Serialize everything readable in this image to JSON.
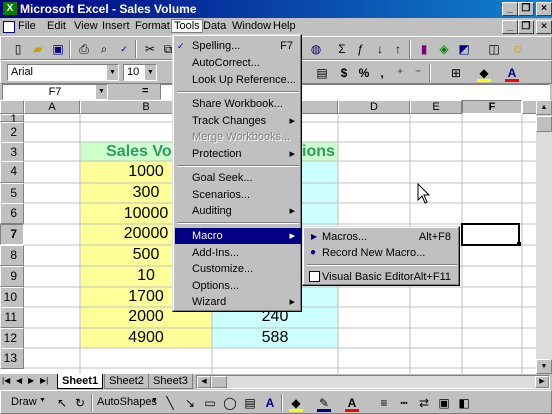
{
  "title_bar": {
    "title": "Microsoft Excel - Sales Volume",
    "min": "_",
    "restore": "❐",
    "close": "×"
  },
  "doc_controls": {
    "min": "_",
    "restore": "❐",
    "close": "×"
  },
  "menubar": [
    "File",
    "Edit",
    "View",
    "Insert",
    "Format",
    "Tools",
    "Data",
    "Window",
    "Help"
  ],
  "formatting": {
    "font": "Arial",
    "size": "10",
    "currency": "$",
    "percent": "%",
    "comma": ","
  },
  "formula_bar": {
    "name_box": "F7",
    "equals": "="
  },
  "columns": [
    "A",
    "B",
    "C",
    "D",
    "E",
    "F"
  ],
  "rows": [
    "1",
    "2",
    "3",
    "4",
    "5",
    "6",
    "7",
    "8",
    "9",
    "10",
    "11",
    "12",
    "13"
  ],
  "cells": {
    "b3": "Sales Volu",
    "c3": "ions",
    "b4": "1000",
    "b5": "300",
    "b6": "10000",
    "b7": "20000",
    "b8": "500",
    "b9": "10",
    "b10": "1700",
    "b11": "2000",
    "b12": "4900",
    "c11": "240",
    "c12": "588"
  },
  "tools_menu": {
    "spelling": "Spelling...",
    "spelling_sc": "F7",
    "autocorrect": "AutoCorrect...",
    "lookup": "Look Up Reference...",
    "share": "Share Workbook...",
    "track": "Track Changes",
    "merge": "Merge Workbooks...",
    "protection": "Protection",
    "goalseek": "Goal Seek...",
    "scenarios": "Scenarios...",
    "auditing": "Auditing",
    "macro": "Macro",
    "addins": "Add-Ins...",
    "customize": "Customize...",
    "options": "Options...",
    "wizard": "Wizard"
  },
  "macro_menu": {
    "macros": "Macros...",
    "macros_sc": "Alt+F8",
    "record": "Record New Macro...",
    "vbe": "Visual Basic Editor",
    "vbe_sc": "Alt+F11"
  },
  "sheet_tabs": [
    "Sheet1",
    "Sheet2",
    "Sheet3"
  ],
  "draw_toolbar": {
    "draw": "Draw",
    "autoshapes": "AutoShapes"
  },
  "colors": {
    "yellow": "#ffff99",
    "cyan": "#ccffff",
    "green_header": "#ccffcc",
    "header_text": "#339966"
  }
}
